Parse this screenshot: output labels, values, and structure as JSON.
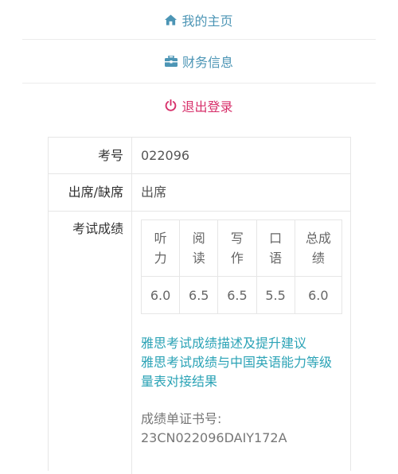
{
  "menu": {
    "home": {
      "label": "我的主页",
      "icon": "home-icon"
    },
    "finance": {
      "label": "财务信息",
      "icon": "briefcase-icon"
    },
    "logout": {
      "label": "退出登录",
      "icon": "power-icon"
    }
  },
  "details": {
    "exam_no": {
      "label": "考号",
      "value": "022096"
    },
    "attendance": {
      "label": "出席/缺席",
      "value": "出席"
    },
    "results": {
      "label": "考试成绩",
      "headers": [
        [
          "听",
          "力"
        ],
        [
          "阅",
          "读"
        ],
        [
          "写",
          "作"
        ],
        [
          "口",
          "语"
        ],
        [
          "总成",
          "绩"
        ]
      ],
      "scores": [
        "6.0",
        "6.5",
        "6.5",
        "5.5",
        "6.0"
      ],
      "links": [
        "雅思考试成绩描述及提升建议",
        "雅思考试成绩与中国英语能力等级量表对接结果"
      ],
      "certificate_label": "成绩单证书号:",
      "certificate_number": "23CN022096DAIY172A"
    }
  },
  "colors": {
    "menu_link": "#4c95b5",
    "logout": "#d72f6a",
    "link": "#2ba3b6"
  }
}
